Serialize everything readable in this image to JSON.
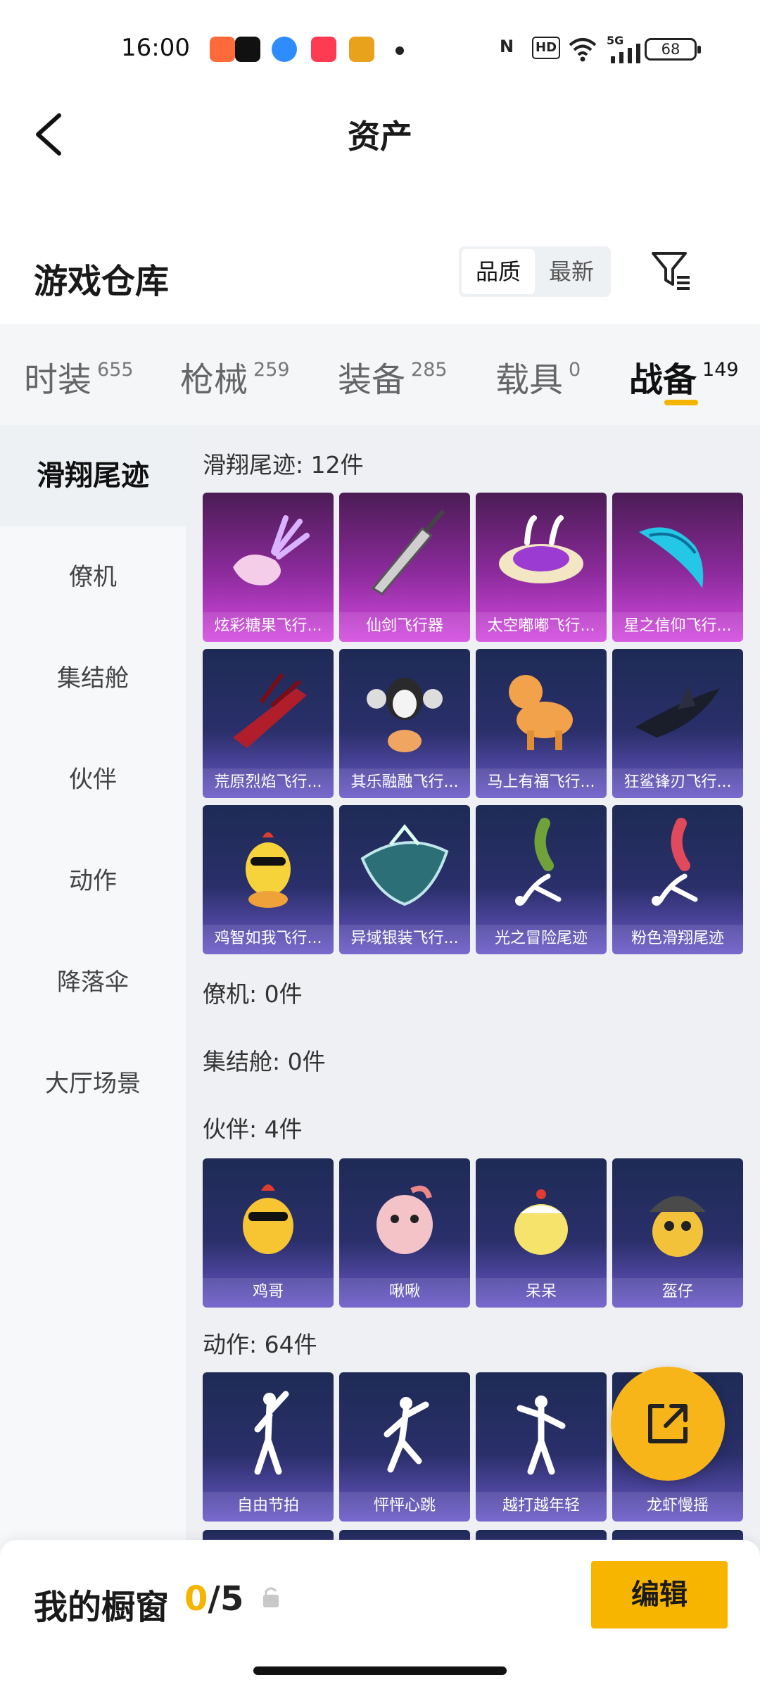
{
  "status_bar": {
    "time": "16:00",
    "network": "5G",
    "hd": "HD",
    "battery": "68"
  },
  "header": {
    "title": "资产"
  },
  "warehouse": {
    "title": "游戏仓库",
    "sort_quality": "品质",
    "sort_latest": "最新"
  },
  "tabs": [
    {
      "label": "时装",
      "count": "655"
    },
    {
      "label": "枪械",
      "count": "259"
    },
    {
      "label": "装备",
      "count": "285"
    },
    {
      "label": "载具",
      "count": "0"
    },
    {
      "label": "战备",
      "count": "149"
    }
  ],
  "sidebar": [
    {
      "label": "滑翔尾迹"
    },
    {
      "label": "僚机"
    },
    {
      "label": "集结舱"
    },
    {
      "label": "伙伴"
    },
    {
      "label": "动作"
    },
    {
      "label": "降落伞"
    },
    {
      "label": "大厅场景"
    }
  ],
  "sections": {
    "trail": {
      "label": "滑翔尾迹: 12件",
      "items": [
        {
          "name": "炫彩糖果飞行...",
          "icon": "candy-glider-icon",
          "rarity": "pink"
        },
        {
          "name": "仙剑飞行器",
          "icon": "sword-glider-icon",
          "rarity": "pink"
        },
        {
          "name": "太空嘟嘟飞行...",
          "icon": "ufo-glider-icon",
          "rarity": "pink"
        },
        {
          "name": "星之信仰飞行...",
          "icon": "wing-glider-icon",
          "rarity": "pink"
        },
        {
          "name": "荒原烈焰飞行...",
          "icon": "flame-glider-icon",
          "rarity": "purple"
        },
        {
          "name": "其乐融融飞行...",
          "icon": "penguin-glider-icon",
          "rarity": "purple"
        },
        {
          "name": "马上有福飞行...",
          "icon": "horse-glider-icon",
          "rarity": "purple"
        },
        {
          "name": "狂鲨锋刃飞行...",
          "icon": "shark-glider-icon",
          "rarity": "purple"
        },
        {
          "name": "鸡智如我飞行...",
          "icon": "chicken-glider-icon",
          "rarity": "purple"
        },
        {
          "name": "异域银装飞行...",
          "icon": "silver-glider-icon",
          "rarity": "purple"
        },
        {
          "name": "光之冒险尾迹",
          "icon": "green-smoke-trail-icon",
          "rarity": "purple"
        },
        {
          "name": "粉色滑翔尾迹",
          "icon": "pink-smoke-trail-icon",
          "rarity": "purple"
        }
      ]
    },
    "drone": {
      "label": "僚机: 0件"
    },
    "pod": {
      "label": "集结舱: 0件"
    },
    "companion": {
      "label": "伙伴: 4件",
      "items": [
        {
          "name": "鸡哥",
          "icon": "chicken-companion-icon"
        },
        {
          "name": "啾啾",
          "icon": "pink-bird-companion-icon"
        },
        {
          "name": "呆呆",
          "icon": "chick-companion-icon"
        },
        {
          "name": "盔仔",
          "icon": "helmet-chick-companion-icon"
        }
      ]
    },
    "emote": {
      "label": "动作: 64件",
      "items": [
        {
          "name": "自由节拍",
          "icon": "dance-emote-icon"
        },
        {
          "name": "怦怦心跳",
          "icon": "heartbeat-emote-icon"
        },
        {
          "name": "越打越年轻",
          "icon": "young-emote-icon"
        },
        {
          "name": "龙虾慢摇",
          "icon": "lobster-emote-icon"
        }
      ]
    }
  },
  "showcase": {
    "title": "我的橱窗",
    "current": "0",
    "separator": "/",
    "max": "5",
    "edit_label": "编辑"
  },
  "colors": {
    "accent": "#f5b400",
    "pink_card": "#8e2b9e",
    "purple_card": "#2a2f6a"
  }
}
